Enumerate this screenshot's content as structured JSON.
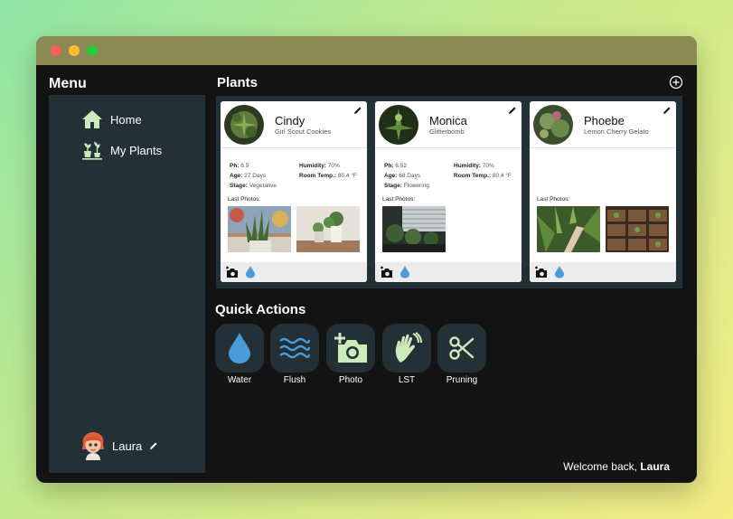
{
  "menu": {
    "title": "Menu",
    "items": [
      {
        "label": "Home",
        "icon": "home-icon"
      },
      {
        "label": "My Plants",
        "icon": "potted-plants-icon"
      }
    ]
  },
  "user": {
    "name": "Laura",
    "avatar": "avatar"
  },
  "plants_section": {
    "title": "Plants"
  },
  "plants": [
    {
      "name": "Cindy",
      "strain": "Girl Scout Cookies",
      "ph_label": "Ph:",
      "ph": "6.5",
      "age_label": "Age:",
      "age": "27 Days",
      "stage_label": "Stage:",
      "stage": "Vegetative",
      "humidity_label": "Humidity:",
      "humidity": "70%",
      "temp_label": "Room Temp.:",
      "temp": "80.4 °F",
      "photos_label": "Last Photos:"
    },
    {
      "name": "Monica",
      "strain": "Glitterbomb",
      "ph_label": "Ph:",
      "ph": "6.52",
      "age_label": "Age:",
      "age": "68 Days",
      "stage_label": "Stage:",
      "stage": "Flowering",
      "humidity_label": "Humidity:",
      "humidity": "70%",
      "temp_label": "Room Temp.:",
      "temp": "80.4 °F",
      "photos_label": "Last Photos:"
    },
    {
      "name": "Phoebe",
      "strain": "Lemon Cherry Gelato",
      "photos_label": "Last Photos:"
    }
  ],
  "quick_actions": {
    "title": "Quick Actions",
    "items": [
      {
        "label": "Water",
        "icon": "water-drop-icon"
      },
      {
        "label": "Flush",
        "icon": "waves-icon"
      },
      {
        "label": "Photo",
        "icon": "add-photo-icon"
      },
      {
        "label": "LST",
        "icon": "hand-icon"
      },
      {
        "label": "Pruning",
        "icon": "scissors-icon"
      }
    ]
  },
  "footer": {
    "welcome_prefix": "Welcome back, ",
    "welcome_name": "Laura"
  },
  "colors": {
    "accent": "#cdeabb",
    "water_blue": "#4a9bd8",
    "sidebar": "#233035",
    "background": "#131313"
  }
}
